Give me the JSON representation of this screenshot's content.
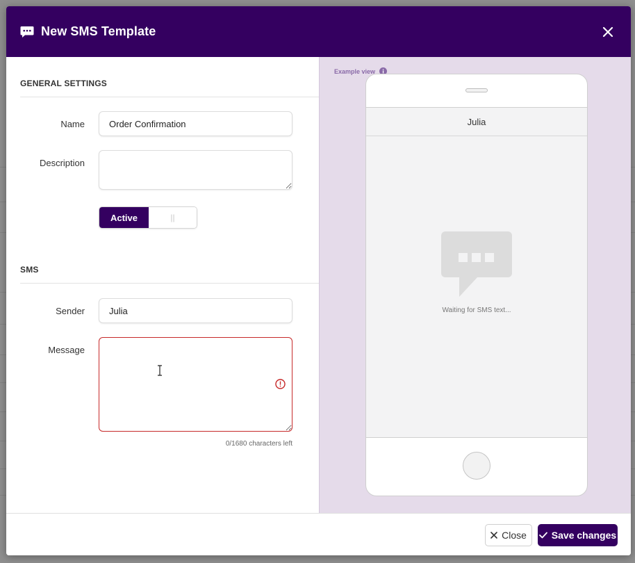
{
  "modal": {
    "title": "New SMS Template",
    "icon": "chat-bubble-icon",
    "close_icon": "close-icon"
  },
  "general_settings": {
    "heading": "GENERAL SETTINGS",
    "name_label": "Name",
    "name_value": "Order Confirmation",
    "description_label": "Description",
    "description_value": "",
    "toggle_on_label": "Active",
    "toggle_off_label": "||"
  },
  "sms": {
    "heading": "SMS",
    "sender_label": "Sender",
    "sender_value": "Julia",
    "message_label": "Message",
    "message_value": "",
    "chars_left": "0/1680 characters left"
  },
  "preview": {
    "label": "Example view",
    "contact_name": "Julia",
    "waiting_text": "Waiting for SMS text..."
  },
  "footer": {
    "close_label": "Close",
    "save_label": "Save changes"
  },
  "colors": {
    "brand": "#340060",
    "preview_bg": "#e5dbea",
    "error": "#c62828"
  }
}
